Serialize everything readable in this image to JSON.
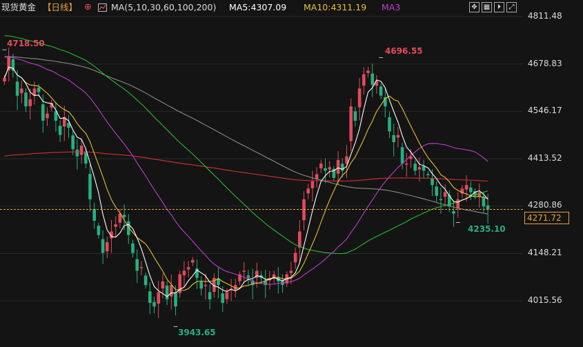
{
  "header": {
    "symbol": "现货黄金",
    "period": "【日线】",
    "period_icon": "circle-plus-icon",
    "ma_icon": "ma-chart-icon",
    "ma_label": "MA(5,10,30,60,100,200)",
    "ma5_label": "MA5:4307.09",
    "ma10_label": "MA10:4311.19",
    "ma3_label": "MA3",
    "toolbar": [
      {
        "name": "zoom-icon",
        "glyph": "✥"
      },
      {
        "name": "grid-icon",
        "glyph": "▦"
      },
      {
        "name": "step-forward-icon",
        "glyph": "⏵"
      },
      {
        "name": "expand-icon",
        "glyph": "⤢"
      }
    ]
  },
  "colors": {
    "up": "#e14c5a",
    "down": "#26b082",
    "ma5": "#ffffff",
    "ma10": "#e6c12f",
    "ma30": "#c23ad6",
    "ma60": "#1fbf2a",
    "ma100": "#8a8a8a",
    "ma200": "#d33030",
    "current": "#e9a23b"
  },
  "chart_data": {
    "type": "candlestick",
    "y_axis_ticks": [
      "4811.48",
      "4678.83",
      "4546.17",
      "4413.52",
      "4280.86",
      "4148.21",
      "4015.56"
    ],
    "ylim": [
      3920,
      4830
    ],
    "current_price": "4271.72",
    "annotations": [
      {
        "text": "4718.50",
        "price": 4718.5
      },
      {
        "text": "4696.55",
        "price": 4696.55
      },
      {
        "text": "3943.65",
        "price": 3943.65
      },
      {
        "text": "4235.10",
        "price": 4235.1
      }
    ],
    "close": [
      4640,
      4700,
      4660,
      4590,
      4610,
      4560,
      4580,
      4610,
      4600,
      4520,
      4540,
      4570,
      4520,
      4480,
      4530,
      4500,
      4440,
      4420,
      4450,
      4400,
      4300,
      4240,
      4200,
      4150,
      4180,
      4210,
      4230,
      4260,
      4250,
      4200,
      4150,
      4100,
      4110,
      4060,
      4010,
      4000,
      4040,
      4070,
      4020,
      4060,
      4000,
      4090,
      4100,
      4110,
      4130,
      4080,
      4050,
      4060,
      4020,
      4080,
      4060,
      4010,
      4040,
      4050,
      4060,
      4090,
      4100,
      4080,
      4060,
      4100,
      4080,
      4060,
      4080,
      4090,
      4070,
      4060,
      4090,
      4100,
      4150,
      4210,
      4300,
      4330,
      4350,
      4370,
      4400,
      4380,
      4390,
      4360,
      4410,
      4380,
      4420,
      4560,
      4520,
      4610,
      4650,
      4660,
      4620,
      4630,
      4590,
      4560,
      4490,
      4460,
      4480,
      4400,
      4400,
      4420,
      4380,
      4390,
      4380,
      4370,
      4340,
      4310,
      4300,
      4320,
      4280,
      4260,
      4300,
      4330,
      4340,
      4320,
      4310,
      4320,
      4280,
      4271.72
    ],
    "ma_series": [
      {
        "name": "MA5",
        "color_key": "ma5"
      },
      {
        "name": "MA10",
        "color_key": "ma10"
      },
      {
        "name": "MA30",
        "color_key": "ma30"
      },
      {
        "name": "MA60",
        "color_key": "ma60"
      },
      {
        "name": "MA100",
        "color_key": "ma100"
      },
      {
        "name": "MA200",
        "color_key": "ma200"
      }
    ]
  }
}
